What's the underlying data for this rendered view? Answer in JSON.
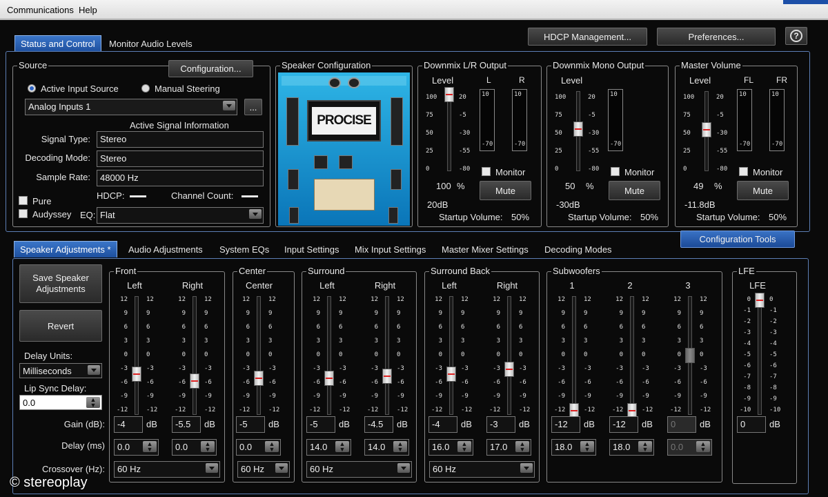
{
  "menu": {
    "communications": "Communications",
    "help": "Help"
  },
  "top_tabs": [
    "Status and Control",
    "Monitor Audio Levels"
  ],
  "top_buttons": {
    "hdcp": "HDCP Management...",
    "preferences": "Preferences...",
    "help": "?"
  },
  "source": {
    "title": "Source",
    "configuration_btn": "Configuration...",
    "radio_active": "Active Input Source",
    "radio_manual": "Manual Steering",
    "input_value": "Analog Inputs 1",
    "ellipsis_btn": "...",
    "active_info_title": "Active Signal Information",
    "signal_type_label": "Signal Type:",
    "signal_type": "Stereo",
    "decoding_mode_label": "Decoding Mode:",
    "decoding_mode": "Stereo",
    "sample_rate_label": "Sample Rate:",
    "sample_rate": "48000 Hz",
    "hdcp_label": "HDCP:",
    "channel_count_label": "Channel Count:",
    "pure_label": "Pure",
    "audyssey_label": "Audyssey",
    "eq_label": "EQ:",
    "eq_value": "Flat"
  },
  "speaker_config": {
    "title": "Speaker Configuration",
    "brand": "PROCISE"
  },
  "downmix_lr": {
    "title": "Downmix L/R Output",
    "level": "Level",
    "ch_l": "L",
    "ch_r": "R",
    "percent": "100",
    "pct": "%",
    "db": "20dB",
    "startup_label": "Startup Volume:",
    "startup_value": "50%",
    "monitor": "Monitor",
    "mute": "Mute",
    "level_fraction": 0.98
  },
  "downmix_mono": {
    "title": "Downmix Mono Output",
    "level": "Level",
    "percent": "50",
    "pct": "%",
    "db": "-30dB",
    "startup_label": "Startup Volume:",
    "startup_value": "50%",
    "monitor": "Monitor",
    "mute": "Mute",
    "level_fraction": 0.5
  },
  "master": {
    "title": "Master Volume",
    "level": "Level",
    "ch_fl": "FL",
    "ch_fr": "FR",
    "percent": "49",
    "pct": "%",
    "db": "-11.8dB",
    "startup_label": "Startup Volume:",
    "startup_value": "50%",
    "monitor": "Monitor",
    "mute": "Mute",
    "level_fraction": 0.49
  },
  "level_scale": [
    "100",
    "75",
    "50",
    "25",
    "0"
  ],
  "db_scale": [
    "20",
    "-5",
    "-30",
    "-55",
    "-80"
  ],
  "meter_scale": [
    "10",
    "-70"
  ],
  "config_tools": "Configuration Tools",
  "bottom_tabs": [
    "Speaker Adjustments *",
    "Audio Adjustments",
    "System EQs",
    "Input Settings",
    "Mix Input Settings",
    "Master Mixer Settings",
    "Decoding Modes"
  ],
  "left_controls": {
    "save_btn": "Save Speaker Adjustments",
    "revert_btn": "Revert",
    "delay_units_label": "Delay Units:",
    "delay_units": "Milliseconds",
    "lip_sync_label": "Lip Sync Delay:",
    "lip_sync": "0.0",
    "gain_label": "Gain (dB):",
    "delay_label": "Delay (ms)",
    "crossover_label": "Crossover (Hz):"
  },
  "db_unit": "dB",
  "speaker_scale": [
    "12",
    "9",
    "6",
    "3",
    "0",
    "-3",
    "-6",
    "-9",
    "-12"
  ],
  "lfe_scale": [
    "0",
    "-1",
    "-2",
    "-3",
    "-4",
    "-5",
    "-6",
    "-7",
    "-8",
    "-9",
    "-10"
  ],
  "groups": [
    {
      "title": "Front",
      "crossover": "60 Hz",
      "channels": [
        {
          "name": "Left",
          "gain": "-4",
          "delay": "0.0"
        },
        {
          "name": "Right",
          "gain": "-5.5",
          "delay": "0.0"
        }
      ]
    },
    {
      "title": "Center",
      "crossover": "60 Hz",
      "channels": [
        {
          "name": "Center",
          "gain": "-5",
          "delay": "0.0"
        }
      ]
    },
    {
      "title": "Surround",
      "crossover": "60 Hz",
      "channels": [
        {
          "name": "Left",
          "gain": "-5",
          "delay": "14.0"
        },
        {
          "name": "Right",
          "gain": "-4.5",
          "delay": "14.0"
        }
      ]
    },
    {
      "title": "Surround Back",
      "crossover": "60 Hz",
      "channels": [
        {
          "name": "Left",
          "gain": "-4",
          "delay": "16.0"
        },
        {
          "name": "Right",
          "gain": "-3",
          "delay": "17.0"
        }
      ]
    },
    {
      "title": "Subwoofers",
      "channels": [
        {
          "name": "1",
          "gain": "-12",
          "delay": "18.0"
        },
        {
          "name": "2",
          "gain": "-12",
          "delay": "18.0"
        },
        {
          "name": "3",
          "gain": "0",
          "delay": "0.0",
          "disabled": true
        }
      ]
    },
    {
      "title": "LFE",
      "channels": [
        {
          "name": "LFE",
          "gain": "0"
        }
      ]
    }
  ],
  "watermark": "© stereoplay"
}
